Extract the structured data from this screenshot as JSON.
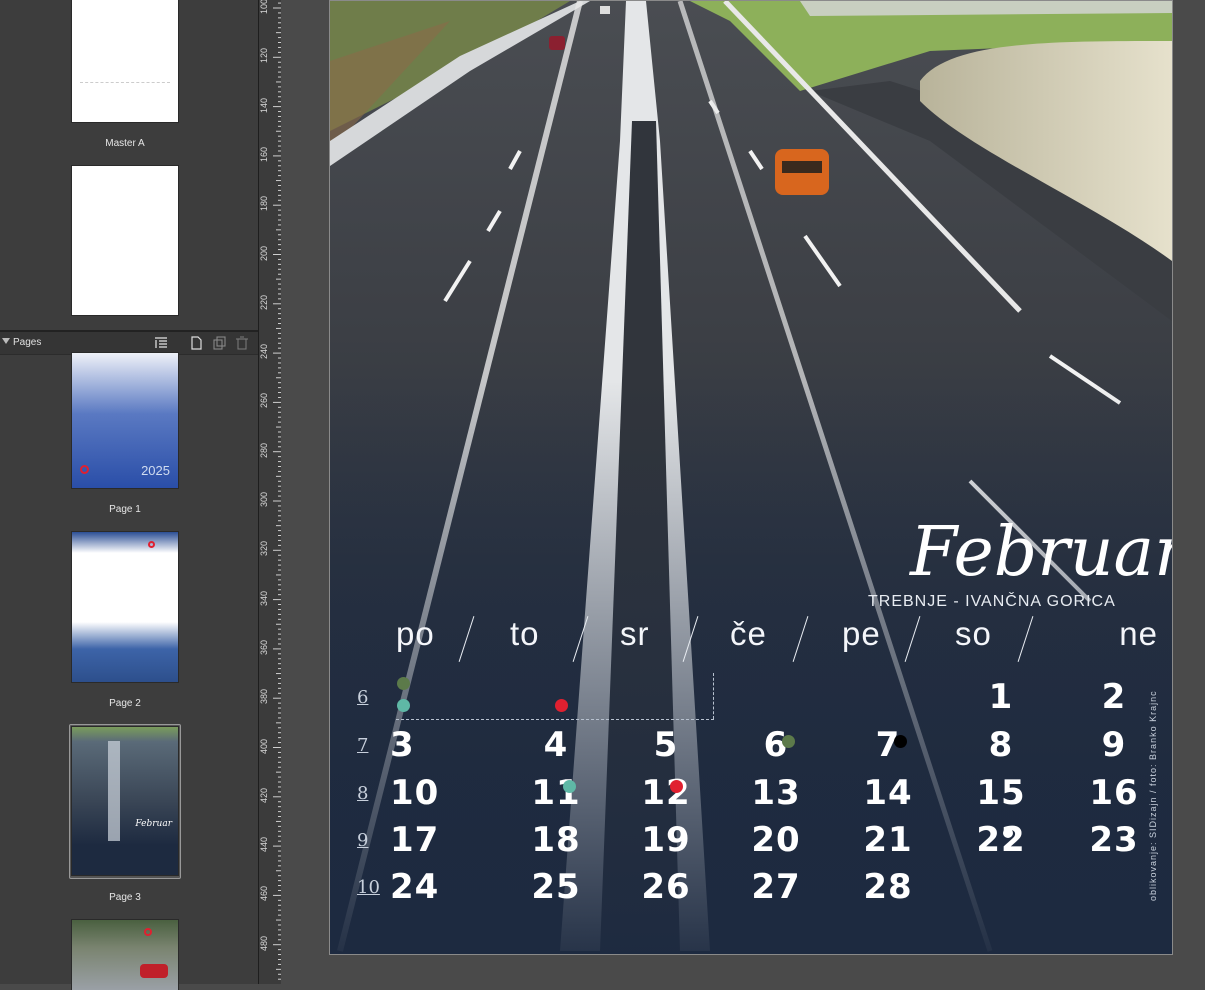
{
  "panel": {
    "master_label": "Master A",
    "pages_title": "Pages",
    "pages": [
      {
        "label": "Page 1",
        "year": "2025"
      },
      {
        "label": "Page 2"
      },
      {
        "label": "Page 3"
      },
      {
        "label": ""
      }
    ]
  },
  "ruler": {
    "ticks": [
      "100",
      "120",
      "140",
      "160",
      "180",
      "200",
      "220",
      "240",
      "260",
      "280",
      "300",
      "320",
      "340",
      "360",
      "380",
      "400",
      "420",
      "440",
      "460",
      "480"
    ]
  },
  "calendar": {
    "month": "Februar",
    "location": "TREBNJE - IVANČNA GORICA",
    "credit": "oblikovanje: SIDizajn / foto: Branko Krajnc",
    "weekdays": [
      "po",
      "to",
      "sr",
      "če",
      "pe",
      "so",
      "ne"
    ],
    "weeks": [
      {
        "num": "6",
        "days": [
          "",
          "",
          "",
          "",
          "",
          "1",
          "2"
        ]
      },
      {
        "num": "7",
        "days": [
          "3",
          "4",
          "5",
          "6",
          "7",
          "8",
          "9"
        ]
      },
      {
        "num": "8",
        "days": [
          "10",
          "11",
          "12",
          "13",
          "14",
          "15",
          "16"
        ]
      },
      {
        "num": "9",
        "days": [
          "17",
          "18",
          "19",
          "20",
          "21",
          "22",
          "23"
        ]
      },
      {
        "num": "10",
        "days": [
          "24",
          "25",
          "26",
          "27",
          "28",
          "",
          ""
        ]
      }
    ],
    "colors": {
      "green": "#5c7a4a",
      "teal": "#5fb8a6",
      "red": "#e02030",
      "black": "#000000"
    }
  }
}
